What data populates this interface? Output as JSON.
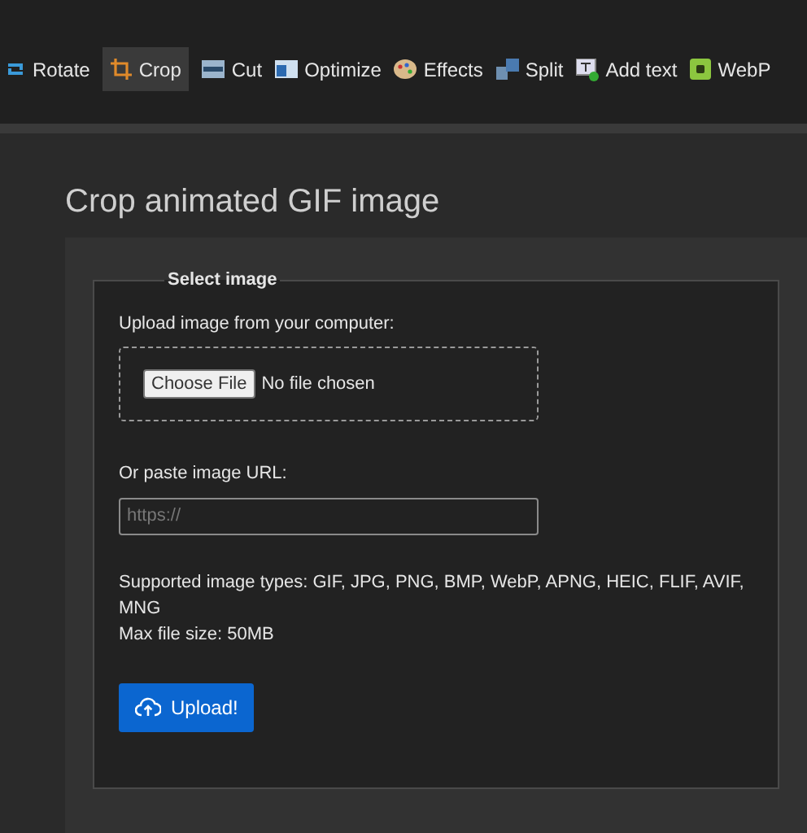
{
  "nav": [
    {
      "label": "Rotate",
      "selected": false
    },
    {
      "label": "Crop",
      "selected": true
    },
    {
      "label": "Cut",
      "selected": false
    },
    {
      "label": "Optimize",
      "selected": false
    },
    {
      "label": "Effects",
      "selected": false
    },
    {
      "label": "Split",
      "selected": false
    },
    {
      "label": "Add text",
      "selected": false
    },
    {
      "label": "WebP",
      "selected": false
    }
  ],
  "title": "Crop animated GIF image",
  "form": {
    "legend": "Select image",
    "upload_label": "Upload image from your computer:",
    "file_button": "Choose File",
    "file_status": "No file chosen",
    "url_label": "Or paste image URL:",
    "url_placeholder": "https://",
    "supported": "Supported image types: GIF, JPG, PNG, BMP, WebP, APNG, HEIC, FLIF, AVIF, MNG",
    "max_size": "Max file size: 50MB",
    "submit": "Upload!"
  }
}
